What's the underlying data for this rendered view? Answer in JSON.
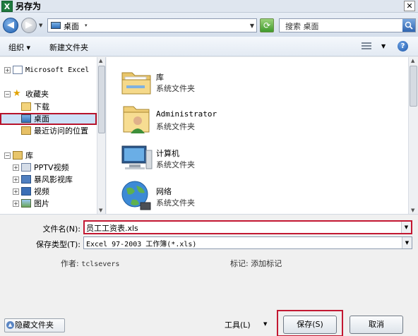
{
  "window": {
    "title": "另存为",
    "app_icon_glyph": "X",
    "close_glyph": "✕"
  },
  "nav": {
    "back_glyph": "◀",
    "forward_glyph": "▶",
    "address": "桌面",
    "search_placeholder": "搜索 桌面"
  },
  "toolbar": {
    "organize": "组织 ▾",
    "new_folder": "新建文件夹"
  },
  "tree": {
    "microsoft_excel": "Microsoft Excel",
    "favorites": "收藏夹",
    "downloads": "下载",
    "desktop": "桌面",
    "recent": "最近访问的位置",
    "libraries": "库",
    "pptv": "PPTV视频",
    "storm": "暴风影视库",
    "videos": "视频",
    "pictures": "图片"
  },
  "files": [
    {
      "name": "库",
      "desc": "系统文件夹",
      "icon": "library-icon"
    },
    {
      "name": "Administrator",
      "desc": "系统文件夹",
      "icon": "user-folder-icon"
    },
    {
      "name": "计算机",
      "desc": "系统文件夹",
      "icon": "computer-icon"
    },
    {
      "name": "网络",
      "desc": "系统文件夹",
      "icon": "network-icon"
    }
  ],
  "form": {
    "filename_label": "文件名(N):",
    "filename_value": "员工工资表.xls",
    "filetype_label": "保存类型(T):",
    "filetype_value": "Excel 97-2003 工作簿(*.xls)",
    "author_label": "作者:",
    "author_value": "tclsevers",
    "tags_label": "标记:",
    "tags_value": "添加标记"
  },
  "footer": {
    "hide_folders": "隐藏文件夹",
    "tools": "工具(L)",
    "save": "保存(S)",
    "cancel": "取消"
  },
  "colors": {
    "highlight": "#c31832",
    "selection": "#cce0f7"
  }
}
